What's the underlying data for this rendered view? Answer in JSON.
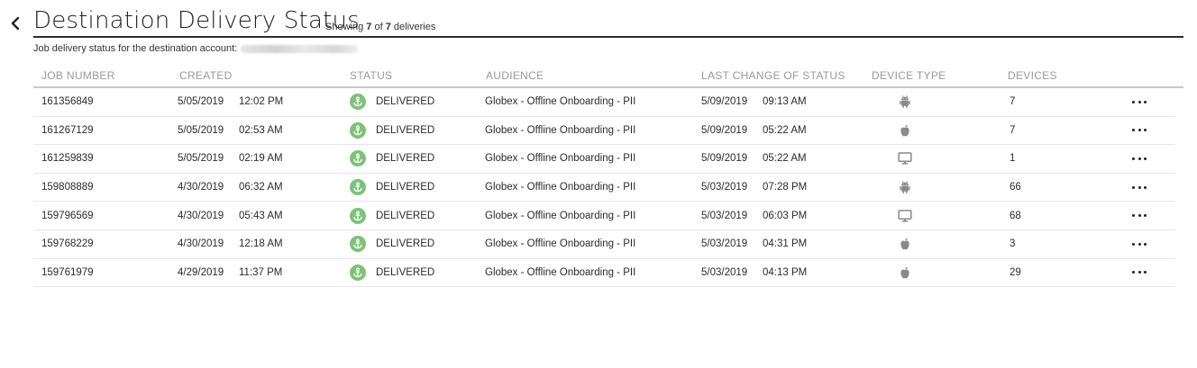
{
  "header": {
    "title": "Destination Delivery Status",
    "showing_prefix": "Showing",
    "showing_count": "7",
    "showing_of": "of",
    "showing_total": "7",
    "showing_suffix": "deliveries"
  },
  "subtitle": {
    "label": "Job delivery status for the destination account:"
  },
  "columns": {
    "job_number": "JOB NUMBER",
    "created": "CREATED",
    "status": "STATUS",
    "audience": "AUDIENCE",
    "last_change": "LAST CHANGE OF STATUS",
    "device_type": "DEVICE TYPE",
    "devices": "DEVICES"
  },
  "colors": {
    "status_delivered": "#7fc17a",
    "device_icon": "#8a8a8a"
  },
  "rows": [
    {
      "job": "161356849",
      "created_date": "5/05/2019",
      "created_time": "12:02 PM",
      "status": "DELIVERED",
      "audience": "Globex - Offline Onboarding - PII",
      "changed_date": "5/09/2019",
      "changed_time": "09:13 AM",
      "device_type": "android-icon",
      "devices": "7"
    },
    {
      "job": "161267129",
      "created_date": "5/05/2019",
      "created_time": "02:53 AM",
      "status": "DELIVERED",
      "audience": "Globex - Offline Onboarding - PII",
      "changed_date": "5/09/2019",
      "changed_time": "05:22 AM",
      "device_type": "apple-icon",
      "devices": "7"
    },
    {
      "job": "161259839",
      "created_date": "5/05/2019",
      "created_time": "02:19 AM",
      "status": "DELIVERED",
      "audience": "Globex - Offline Onboarding - PII",
      "changed_date": "5/09/2019",
      "changed_time": "05:22 AM",
      "device_type": "desktop-icon",
      "devices": "1"
    },
    {
      "job": "159808889",
      "created_date": "4/30/2019",
      "created_time": "06:32 AM",
      "status": "DELIVERED",
      "audience": "Globex - Offline Onboarding - PII",
      "changed_date": "5/03/2019",
      "changed_time": "07:28 PM",
      "device_type": "android-icon",
      "devices": "66"
    },
    {
      "job": "159796569",
      "created_date": "4/30/2019",
      "created_time": "05:43 AM",
      "status": "DELIVERED",
      "audience": "Globex - Offline Onboarding - PII",
      "changed_date": "5/03/2019",
      "changed_time": "06:03 PM",
      "device_type": "desktop-icon",
      "devices": "68"
    },
    {
      "job": "159768229",
      "created_date": "4/30/2019",
      "created_time": "12:18 AM",
      "status": "DELIVERED",
      "audience": "Globex - Offline Onboarding - PII",
      "changed_date": "5/03/2019",
      "changed_time": "04:31 PM",
      "device_type": "apple-icon",
      "devices": "3"
    },
    {
      "job": "159761979",
      "created_date": "4/29/2019",
      "created_time": "11:37 PM",
      "status": "DELIVERED",
      "audience": "Globex - Offline Onboarding - PII",
      "changed_date": "5/03/2019",
      "changed_time": "04:13 PM",
      "device_type": "apple-icon",
      "devices": "29"
    }
  ]
}
